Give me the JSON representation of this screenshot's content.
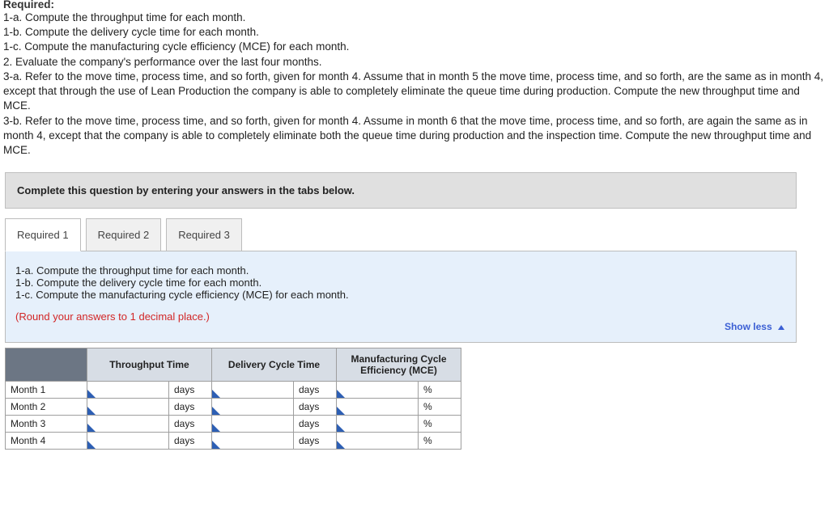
{
  "header": {
    "title": "Required:",
    "lines": [
      "1-a. Compute the throughput time for each month.",
      "1-b. Compute the delivery cycle time for each month.",
      "1-c. Compute the manufacturing cycle efficiency (MCE) for each month.",
      "2. Evaluate the company's performance over the last four months.",
      "3-a. Refer to the move time, process time, and so forth, given for month 4. Assume that in month 5 the move time, process time, and so forth, are the same as in month 4, except that through the use of Lean Production the company is able to completely eliminate the queue time during production.  Compute the new throughput time and MCE.",
      "3-b. Refer to the move time, process time, and so forth, given for month 4. Assume in month 6 that the move time, process time, and so forth, are again the same as in month 4, except that the company is able to completely eliminate both the queue time during production and the inspection time. Compute the new throughput time and MCE."
    ]
  },
  "greyBar": "Complete this question by entering your answers in the tabs below.",
  "tabs": [
    "Required 1",
    "Required 2",
    "Required 3"
  ],
  "panel": {
    "subLines": [
      "1-a. Compute the throughput time for each month.",
      "1-b. Compute the delivery cycle time for each month.",
      "1-c. Compute the manufacturing cycle efficiency (MCE) for each month."
    ],
    "note": "(Round your answers to 1 decimal place.)",
    "showLess": "Show less"
  },
  "table": {
    "headers": [
      "Throughput Time",
      "Delivery Cycle Time",
      "Manufacturing Cycle Efficiency (MCE)"
    ],
    "rows": [
      {
        "label": "Month 1",
        "unitA": "days",
        "unitB": "days",
        "unitC": "%"
      },
      {
        "label": "Month 2",
        "unitA": "days",
        "unitB": "days",
        "unitC": "%"
      },
      {
        "label": "Month 3",
        "unitA": "days",
        "unitB": "days",
        "unitC": "%"
      },
      {
        "label": "Month 4",
        "unitA": "days",
        "unitB": "days",
        "unitC": "%"
      }
    ]
  }
}
